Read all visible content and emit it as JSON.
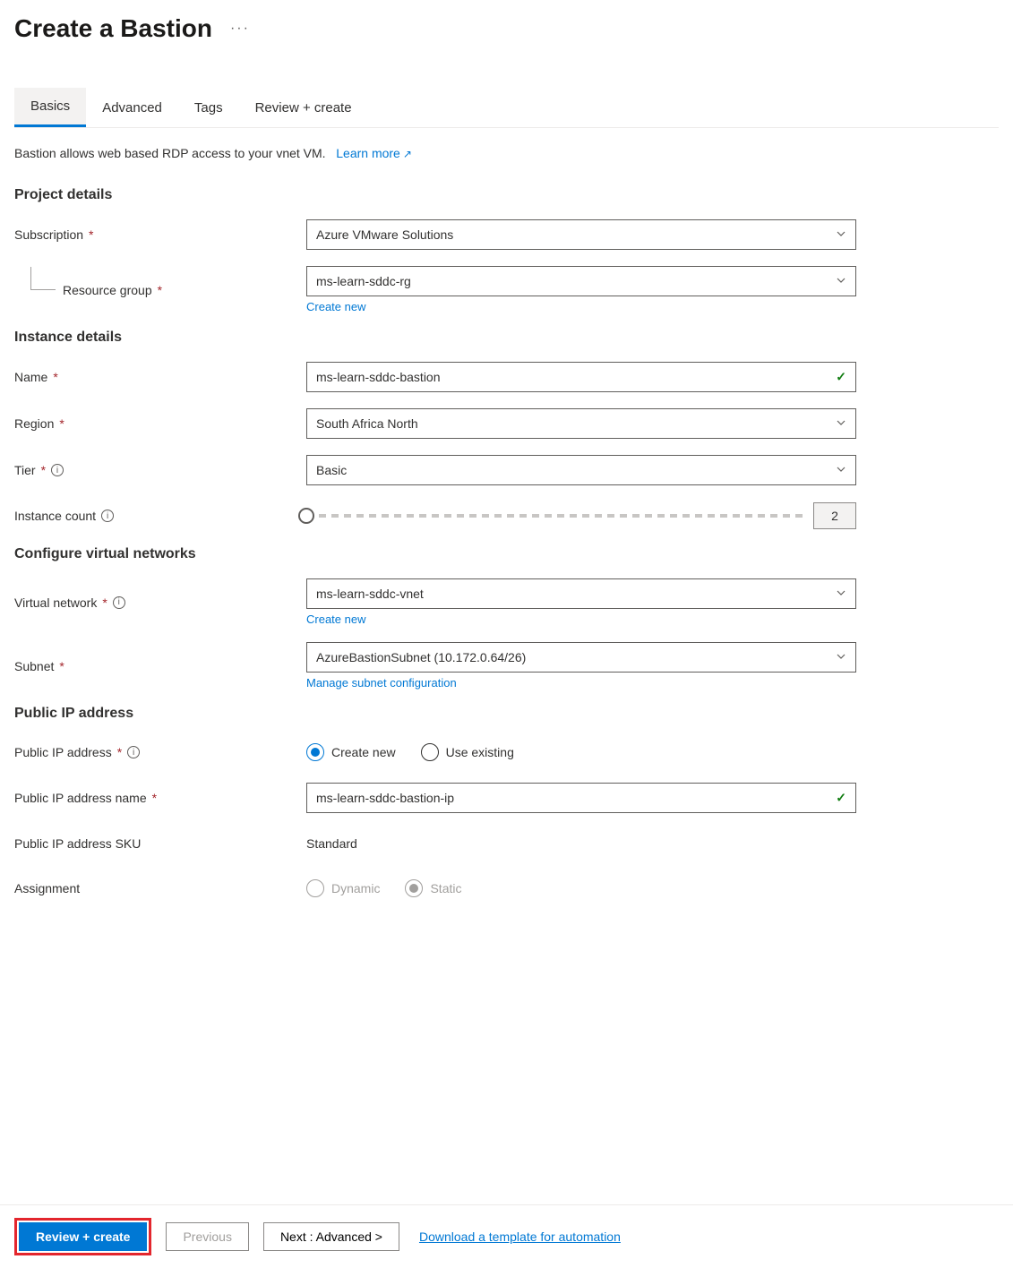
{
  "header": {
    "title": "Create a Bastion"
  },
  "tabs": [
    {
      "label": "Basics",
      "active": true
    },
    {
      "label": "Advanced",
      "active": false
    },
    {
      "label": "Tags",
      "active": false
    },
    {
      "label": "Review + create",
      "active": false
    }
  ],
  "description": {
    "text": "Bastion allows web based RDP access to your vnet VM.",
    "link": "Learn more"
  },
  "sections": {
    "project": {
      "title": "Project details",
      "subscription": {
        "label": "Subscription",
        "value": "Azure VMware Solutions"
      },
      "resource_group": {
        "label": "Resource group",
        "value": "ms-learn-sddc-rg",
        "helper": "Create new"
      }
    },
    "instance": {
      "title": "Instance details",
      "name": {
        "label": "Name",
        "value": "ms-learn-sddc-bastion"
      },
      "region": {
        "label": "Region",
        "value": "South Africa North"
      },
      "tier": {
        "label": "Tier",
        "value": "Basic"
      },
      "instance_count": {
        "label": "Instance count",
        "value": "2"
      }
    },
    "vnet": {
      "title": "Configure virtual networks",
      "virtual_network": {
        "label": "Virtual network",
        "value": "ms-learn-sddc-vnet",
        "helper": "Create new"
      },
      "subnet": {
        "label": "Subnet",
        "value": "AzureBastionSubnet (10.172.0.64/26)",
        "helper": "Manage subnet configuration"
      }
    },
    "public_ip": {
      "title": "Public IP address",
      "address": {
        "label": "Public IP address",
        "opt_new": "Create new",
        "opt_existing": "Use existing"
      },
      "name": {
        "label": "Public IP address name",
        "value": "ms-learn-sddc-bastion-ip"
      },
      "sku": {
        "label": "Public IP address SKU",
        "value": "Standard"
      },
      "assignment": {
        "label": "Assignment",
        "opt_dynamic": "Dynamic",
        "opt_static": "Static"
      }
    }
  },
  "footer": {
    "review": "Review + create",
    "previous": "Previous",
    "next": "Next : Advanced >",
    "download": "Download a template for automation"
  }
}
